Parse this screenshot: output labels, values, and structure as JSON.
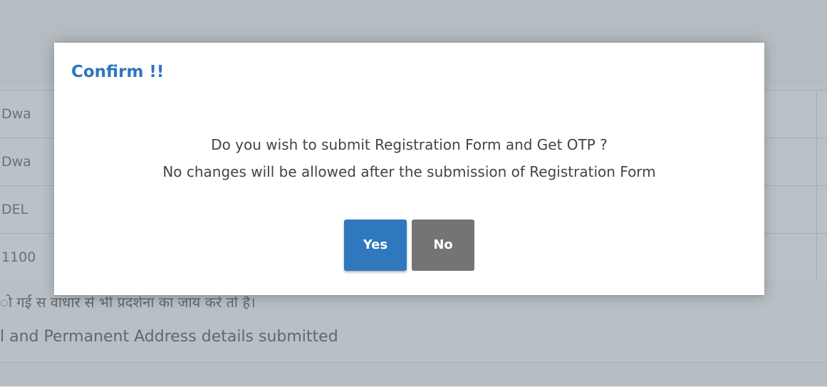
{
  "background": {
    "rows": [
      {
        "value": "Dwa"
      },
      {
        "value": "Dwa"
      },
      {
        "value": "DEL"
      },
      {
        "value": "1100"
      }
    ],
    "note_hindi": "ो गई स वाधार से भी प्रदर्शना का जाय करें तो है।",
    "note_english": "l and Permanent Address details submitted"
  },
  "modal": {
    "title": "Confirm !!",
    "message_line1": "Do you wish to submit Registration Form and Get OTP ?",
    "message_line2": "No changes will be allowed after the submission of Registration Form",
    "yes_label": "Yes",
    "no_label": "No"
  },
  "colors": {
    "title": "#2f75c0",
    "yes_button": "#2f78bd",
    "no_button": "#747474"
  }
}
